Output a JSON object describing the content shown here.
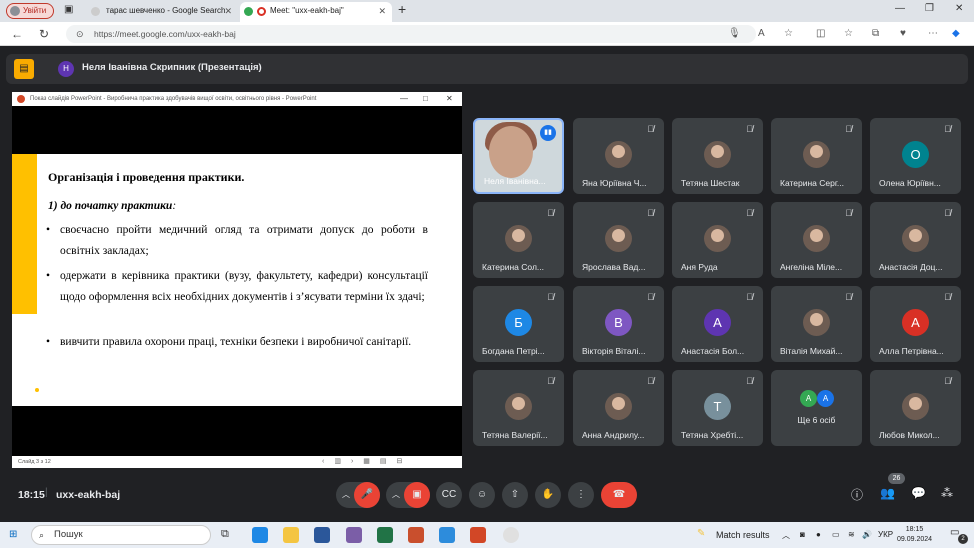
{
  "browser": {
    "profile_label": "Увійти",
    "tabs": [
      {
        "title": "тарас шевченко - Google Search"
      },
      {
        "title": "Meet: \"uxx-eakh-baj\""
      }
    ],
    "new_tab": "+",
    "url": "https://meet.google.com/uxx-eakh-baj"
  },
  "meet": {
    "presenter_initial": "Н",
    "presenter_title": "Неля Іванівна Скрипник (Презентація)",
    "ppt_window_title": "Показ слайдів PowerPoint - Виробнича практика здобувачів вищої освіти, освітнього рівня - PowerPoint",
    "slide": {
      "title": "Організація і проведення практики.",
      "subtitle": "1) до початку практики",
      "subtitle_colon": ":",
      "bullets": [
        "своєчасно пройти медичний огляд та отримати допуск до роботи в освітніх закладах;",
        "одержати в керівника практики (вузу, факультету, кафедри) консультації щодо оформлення всіх необхідних документів і з’ясувати терміни їх здачі;",
        "вивчити правила охорони праці, техніки безпеки і виробничої санітарії."
      ]
    },
    "slide_counter": "Слайд 3 з 12",
    "participants": [
      {
        "name": "Неля Іванівна...",
        "kind": "video"
      },
      {
        "name": "Яна Юріївна Ч...",
        "kind": "photo"
      },
      {
        "name": "Тетяна Шестак",
        "kind": "photo"
      },
      {
        "name": "Катерина Серг...",
        "kind": "photo"
      },
      {
        "name": "Олена Юріївн...",
        "kind": "letter",
        "letter": "О",
        "color": "#00838f"
      },
      {
        "name": "Катерина Сол...",
        "kind": "photo"
      },
      {
        "name": "Ярослава Вад...",
        "kind": "photo"
      },
      {
        "name": "Аня Руда",
        "kind": "photo"
      },
      {
        "name": "Ангеліна Міле...",
        "kind": "photo"
      },
      {
        "name": "Анастасія Доц...",
        "kind": "photo"
      },
      {
        "name": "Богдана Петрі...",
        "kind": "letter",
        "letter": "Б",
        "color": "#1e88e5"
      },
      {
        "name": "Вікторія Віталі...",
        "kind": "letter",
        "letter": "В",
        "color": "#7e57c2"
      },
      {
        "name": "Анастасія Бол...",
        "kind": "letter",
        "letter": "А",
        "color": "#5e35b1"
      },
      {
        "name": "Віталія Михай...",
        "kind": "photo"
      },
      {
        "name": "Алла Петрівна...",
        "kind": "letter",
        "letter": "А",
        "color": "#d93025"
      },
      {
        "name": "Тетяна Валерії...",
        "kind": "photo"
      },
      {
        "name": "Анна Андрилу...",
        "kind": "photo"
      },
      {
        "name": "Тетяна Хребті...",
        "kind": "letter",
        "letter": "Т",
        "color": "#78909c"
      },
      {
        "name": "Ще 6 осіб",
        "kind": "more",
        "letters": [
          "А",
          "А"
        ]
      },
      {
        "name": "Любов Микол...",
        "kind": "photo"
      }
    ],
    "bottom": {
      "time": "18:15",
      "separator": "|",
      "meeting_code": "uxx-eakh-baj",
      "people_count": "26"
    }
  },
  "taskbar": {
    "search_label": "Пошук",
    "match_results": "Match results",
    "language": "УКР",
    "clock_time": "18:15",
    "clock_date": "09.09.2024",
    "notification_count": "2"
  },
  "colors": {
    "meet_bg": "#202124",
    "tile_bg": "#3c4043",
    "accent_yellow": "#ffc000",
    "leave_red": "#ea4335"
  }
}
